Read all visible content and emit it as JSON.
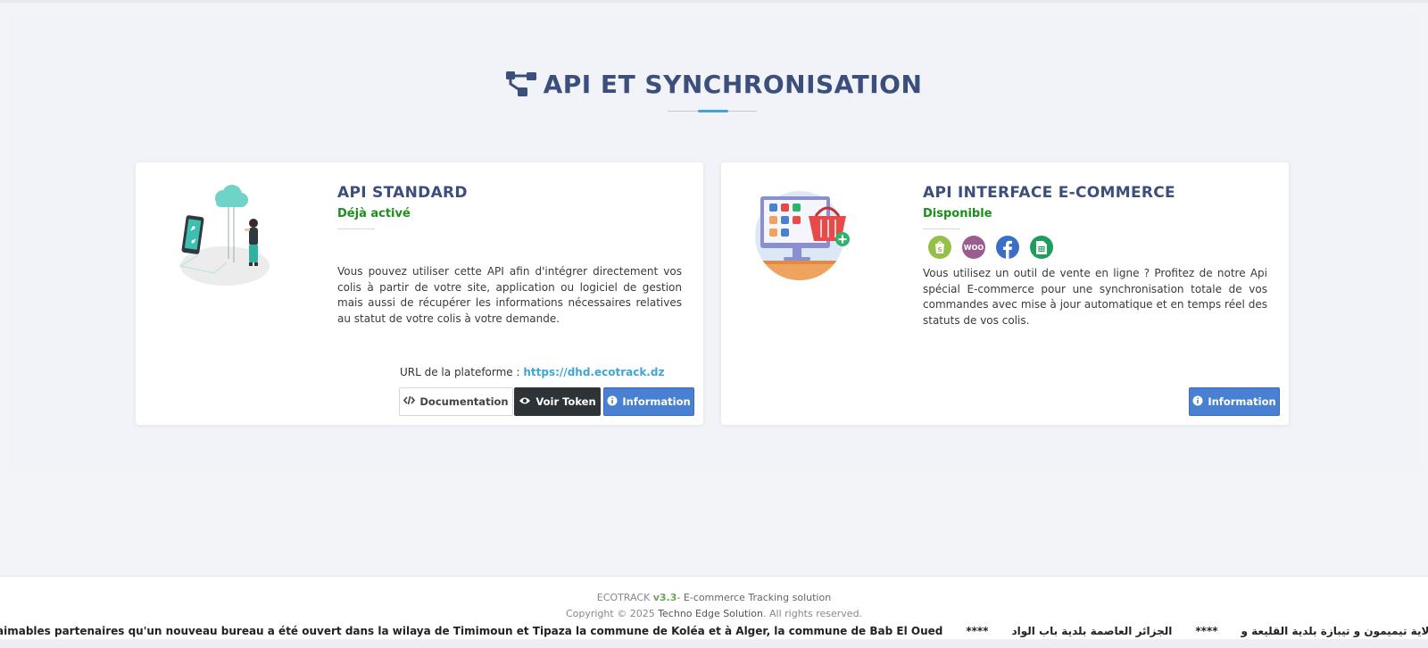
{
  "section": {
    "title": "API ET SYNCHRONISATION",
    "title_icon": "sitemap-icon"
  },
  "cards": {
    "standard": {
      "title": "API STANDARD",
      "status": "Déjà activé",
      "status_color": "#1a8f1a",
      "description": "Vous pouvez utiliser cette API afin d'intégrer directement vos colis à partir de votre site, application ou logiciel de gestion mais aussi de récupérer les informations nécessaires relatives au statut de votre colis à votre demande.",
      "url_label": "URL de la plateforme : ",
      "url": "https://dhd.ecotrack.dz",
      "buttons": {
        "documentation": "Documentation",
        "token": "Voir Token",
        "information": "Information"
      }
    },
    "ecommerce": {
      "title": "API INTERFACE E-COMMERCE",
      "status": "Disponible",
      "status_color": "#1a8f1a",
      "integrations": [
        "shopify-icon",
        "woocommerce-icon",
        "facebook-icon",
        "google-sheets-icon"
      ],
      "woo_label": "WOO",
      "description": "Vous utilisez un outil de vente en ligne ? Profitez de notre Api spécial E-commerce pour une synchronisation totale de vos commandes avec mise à jour automatique et en temps réel des statuts de vos colis.",
      "buttons": {
        "information": "Information"
      }
    }
  },
  "footer": {
    "brand": "ECOTRACK",
    "version": "v3.3",
    "tagline": "- E-commerce Tracking solution",
    "copyright_prefix": "Copyright © 2025 ",
    "company": "Techno Edge Solution",
    "copyright_suffix": ". All rights reserved."
  },
  "ticker": {
    "fr": "aimables partenaires qu'un nouveau bureau a été ouvert dans la wilaya de Timimoun et Tipaza la commune de Koléa et à Alger, la commune de Bab El Oued",
    "sep1": "****",
    "ar1": "الجزائر العاصمة بلدية باب الواد",
    "sep2": "****",
    "ar2": "ام أنه تم فتح مكتب جديد على مستوى ولاية تيميمون و تيبازة بلدية القليعة و"
  },
  "colors": {
    "primary": "#3c4f7c",
    "accent": "#3fa6d3",
    "info_button": "#4a80d2",
    "dark_button": "#2e3338"
  }
}
